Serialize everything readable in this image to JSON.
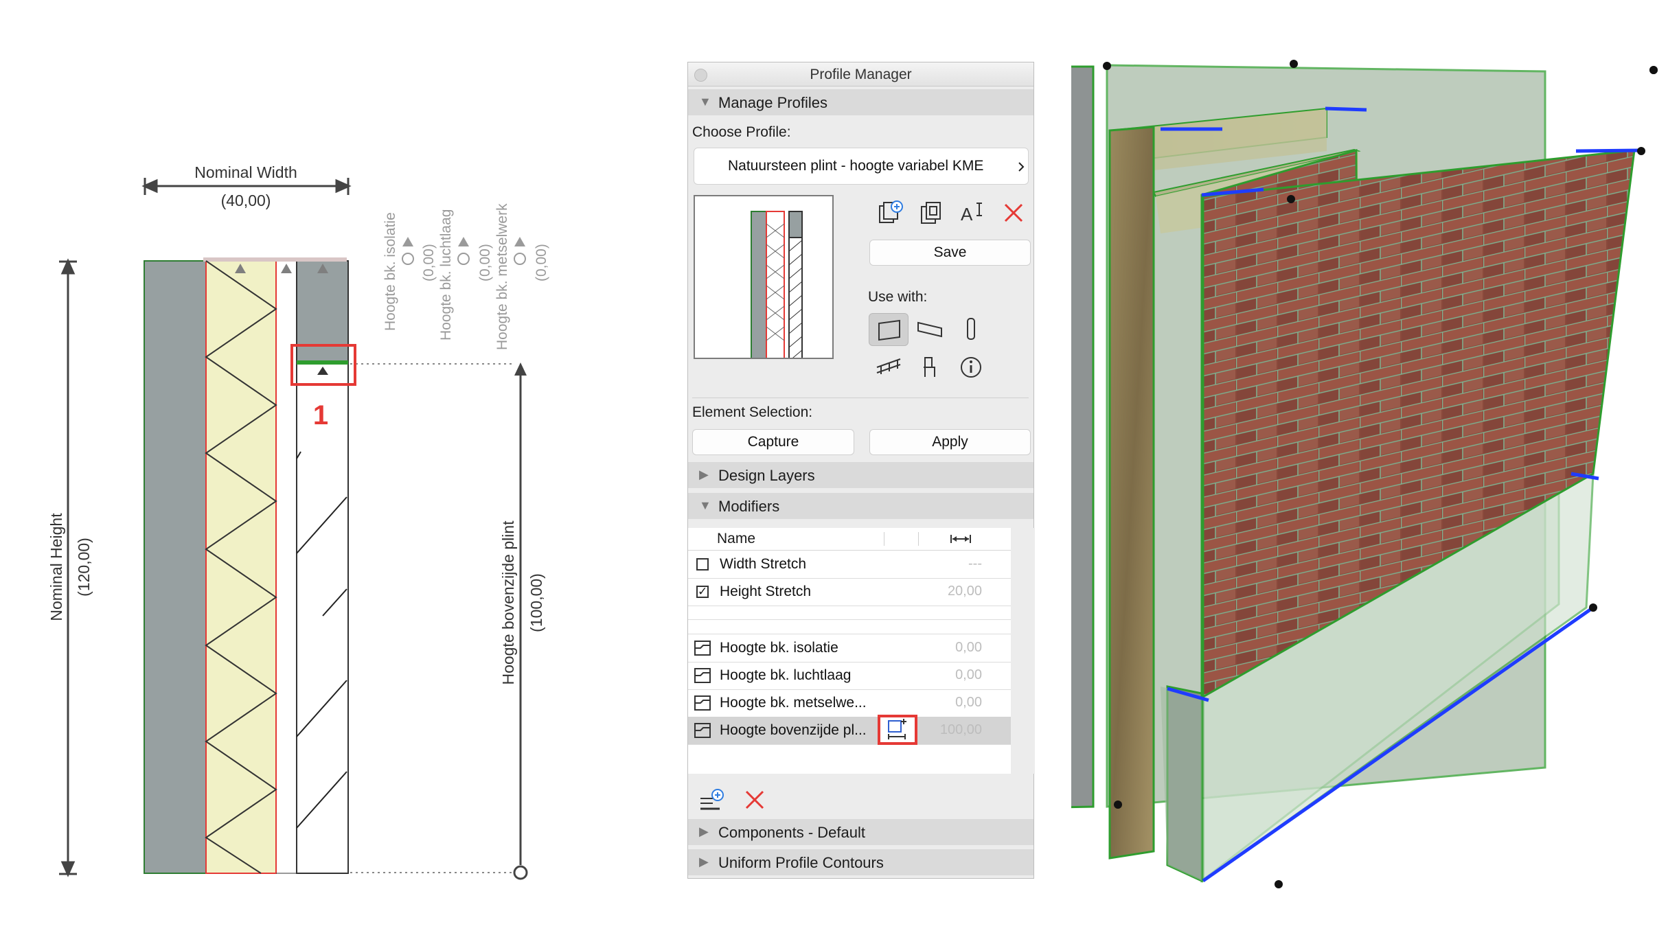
{
  "drawing": {
    "nominal_width_label": "Nominal Width",
    "nominal_width_value": "(40,00)",
    "nominal_height_label": "Nominal Height",
    "nominal_height_value": "(120,00)",
    "plinth_label": "Hoogte bovenzijde plint",
    "plinth_value": "(100,00)",
    "callout_number": "1",
    "rotated_labels": [
      {
        "label": "Hoogte bk. isolatie",
        "value": "(0,00)"
      },
      {
        "label": "Hoogte bk. luchtlaag",
        "value": "(0,00)"
      },
      {
        "label": "Hoogte bk. metselwerk",
        "value": "(0,00)"
      }
    ]
  },
  "palette": {
    "title": "Profile Manager",
    "manage_profiles": "Manage Profiles",
    "choose_profile": "Choose Profile:",
    "selected_profile": "Natuursteen plint - hoogte variabel KME",
    "save": "Save",
    "use_with": "Use with:",
    "element_selection": "Element Selection:",
    "capture": "Capture",
    "apply": "Apply",
    "design_layers": "Design Layers",
    "modifiers": "Modifiers",
    "name_header": "Name",
    "rows": [
      {
        "label": "Width Stretch",
        "value": "---",
        "checked": false
      },
      {
        "label": "Height Stretch",
        "value": "20,00",
        "checked": true
      },
      {
        "label": "Hoogte bk. isolatie",
        "value": "0,00"
      },
      {
        "label": "Hoogte bk. luchtlaag",
        "value": "0,00"
      },
      {
        "label": "Hoogte bk. metselwe...",
        "value": "0,00"
      },
      {
        "label": "Hoogte bovenzijde pl...",
        "value": "100,00"
      }
    ],
    "components": "Components - Default",
    "uniform_contours": "Uniform Profile Contours"
  },
  "colors": {
    "highlight_red": "#e53935",
    "edge_green": "#2e9d2e",
    "edge_blue": "#1f3cff",
    "slate_grey": "#97a0a1",
    "insulation_yellow": "#f1f1c6"
  },
  "icons": [
    "new-profile-icon",
    "duplicate-profile-icon",
    "rename-profile-icon",
    "delete-profile-icon",
    "wall-icon",
    "beam-icon",
    "column-icon",
    "railing-icon",
    "object-icon",
    "info-icon",
    "add-modifier-icon",
    "delete-modifier-icon",
    "modifier-line-icon",
    "add-dimension-icon"
  ]
}
